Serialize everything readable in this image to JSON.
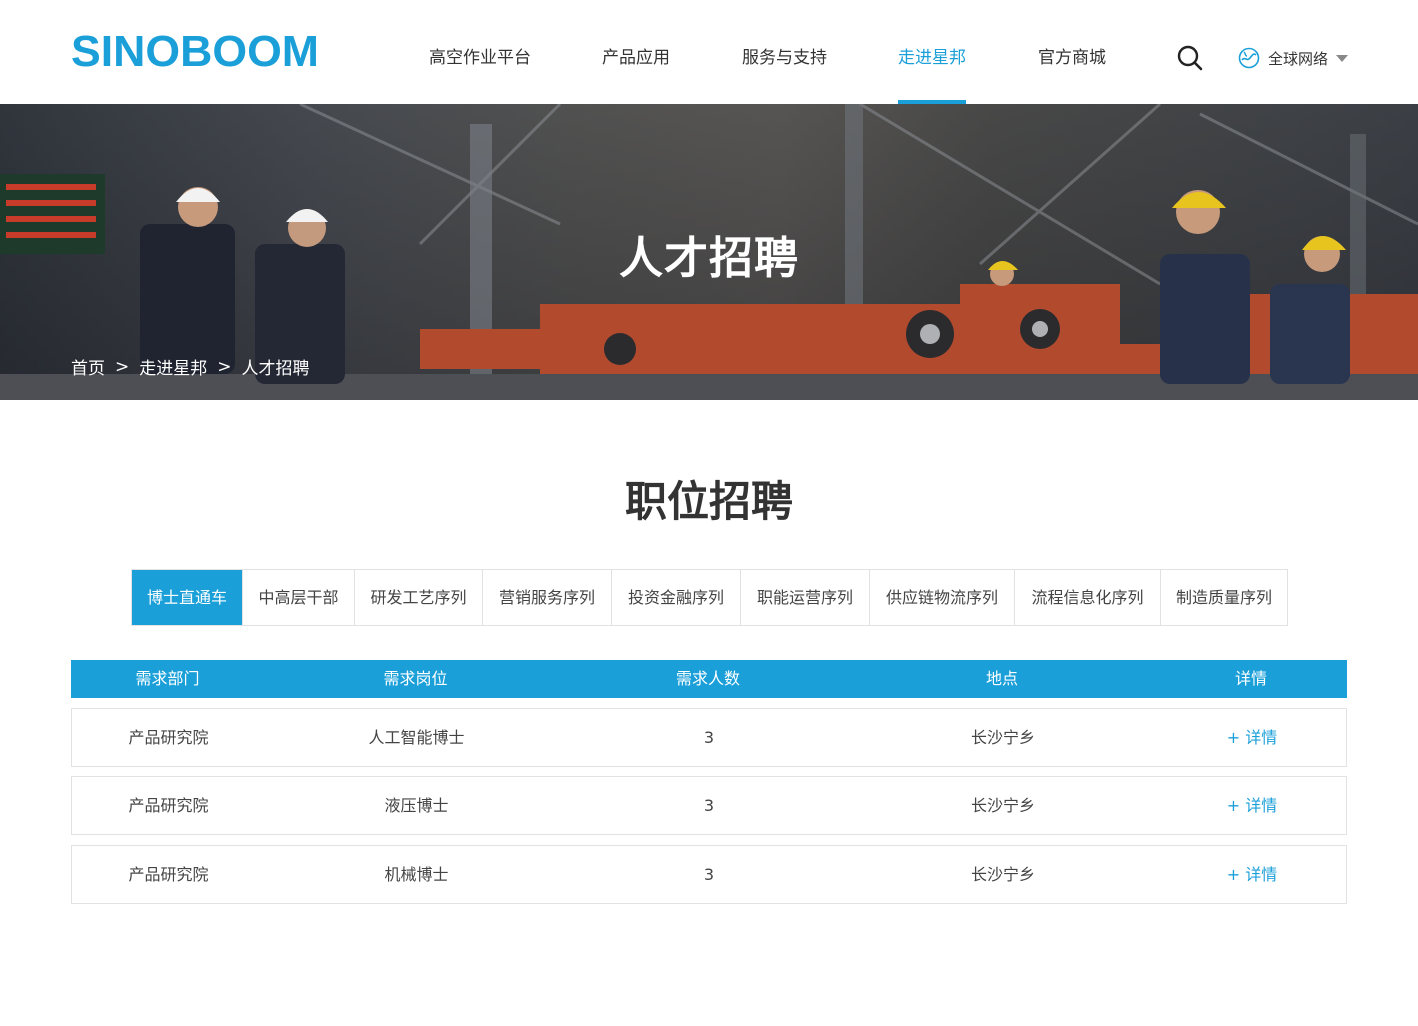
{
  "header": {
    "logo_text": "SINOBOOM",
    "nav": [
      {
        "label": "高空作业平台",
        "active": false
      },
      {
        "label": "产品应用",
        "active": false
      },
      {
        "label": "服务与支持",
        "active": false
      },
      {
        "label": "走进星邦",
        "active": true
      },
      {
        "label": "官方商城",
        "active": false
      }
    ],
    "search_icon": "search-icon",
    "global_label": "全球网络",
    "global_icon": "globe-icon"
  },
  "banner": {
    "title": "人才招聘",
    "breadcrumb": [
      "首页",
      "走进星邦",
      "人才招聘"
    ],
    "separator": ">"
  },
  "section": {
    "title": "职位招聘",
    "tabs": [
      {
        "label": "博士直通车",
        "active": true
      },
      {
        "label": "中高层干部",
        "active": false
      },
      {
        "label": "研发工艺序列",
        "active": false
      },
      {
        "label": "营销服务序列",
        "active": false
      },
      {
        "label": "投资金融序列",
        "active": false
      },
      {
        "label": "职能运营序列",
        "active": false
      },
      {
        "label": "供应链物流序列",
        "active": false
      },
      {
        "label": "流程信息化序列",
        "active": false
      },
      {
        "label": "制造质量序列",
        "active": false
      }
    ]
  },
  "table": {
    "headers": [
      "需求部门",
      "需求岗位",
      "需求人数",
      "地点",
      "详情"
    ],
    "rows": [
      {
        "dept": "产品研究院",
        "position": "人工智能博士",
        "count": "3",
        "location": "长沙宁乡",
        "detail": "+ 详情"
      },
      {
        "dept": "产品研究院",
        "position": "液压博士",
        "count": "3",
        "location": "长沙宁乡",
        "detail": "+ 详情"
      },
      {
        "dept": "产品研究院",
        "position": "机械博士",
        "count": "3",
        "location": "长沙宁乡",
        "detail": "+ 详情"
      }
    ]
  },
  "colors": {
    "accent": "#1a9fd9",
    "text": "#333333",
    "border": "#e2e2e2"
  }
}
